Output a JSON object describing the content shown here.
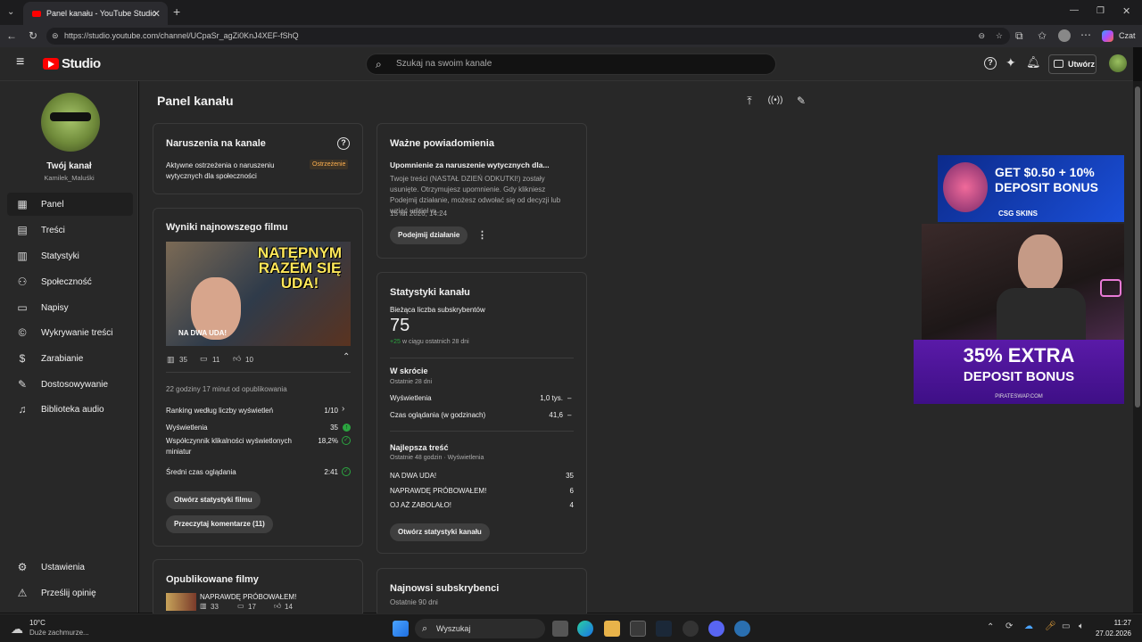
{
  "browser": {
    "tab_title": "Panel kanału - YouTube Studio",
    "url": "https://studio.youtube.com/channel/UCpaSr_agZi0KnJ4XEF-fShQ",
    "chat_label": "Czat"
  },
  "header": {
    "logo_text": "Studio",
    "search_placeholder": "Szukaj na swoim kanale",
    "create_label": "Utwórz"
  },
  "sidebar": {
    "channel_title": "Twój kanał",
    "channel_handle": "Kamilek_Maluśki",
    "items": [
      {
        "label": "Panel",
        "icon": "dashboard-icon"
      },
      {
        "label": "Treści",
        "icon": "content-icon"
      },
      {
        "label": "Statystyki",
        "icon": "analytics-icon"
      },
      {
        "label": "Społeczność",
        "icon": "community-icon"
      },
      {
        "label": "Napisy",
        "icon": "subtitles-icon"
      },
      {
        "label": "Wykrywanie treści",
        "icon": "copyright-icon"
      },
      {
        "label": "Zarabianie",
        "icon": "monetization-icon"
      },
      {
        "label": "Dostosowywanie",
        "icon": "customization-icon"
      },
      {
        "label": "Biblioteka audio",
        "icon": "audio-library-icon"
      }
    ],
    "settings_label": "Ustawienia",
    "feedback_label": "Prześlij opinię"
  },
  "page_title": "Panel kanału",
  "violations": {
    "title": "Naruszenia na kanale",
    "text": "Aktywne ostrzeżenia o naruszeniu wytycznych dla społeczności",
    "badge": "Ostrzeżenie"
  },
  "latest": {
    "title": "Wyniki najnowszego filmu",
    "thumb_text_top": "NATĘPNYM RAZEM SIĘ UDA!",
    "thumb_caption": "NA DWA UDA!",
    "views": "35",
    "comments": "11",
    "likes": "10",
    "published": "22 godziny 17 minut od opublikowania",
    "rows": [
      {
        "label": "Ranking według liczby wyświetleń",
        "value": "1/10"
      },
      {
        "label": "Wyświetlenia",
        "value": "35"
      },
      {
        "label": "Współczynnik klikalności wyświetlonych miniatur",
        "value": "18,2%"
      },
      {
        "label": "Średni czas oglądania",
        "value": "2:41"
      }
    ],
    "btn_stats": "Otwórz statystyki filmu",
    "btn_comments": "Przeczytaj komentarze (11)"
  },
  "published_videos": {
    "title": "Opublikowane filmy",
    "item_title": "NAPRAWDĘ PRÓBOWAŁEM!",
    "item_views": "33",
    "item_comments": "17",
    "item_likes": "14"
  },
  "notifications": {
    "title": "Ważne powiadomienia",
    "subtitle": "Upomnienie za naruszenie wytycznych dla...",
    "body": "Twoje treści (NASTAŁ DZIEŃ ODKUTKI!) zostały usunięte. Otrzymujesz upomnienie. Gdy klikniesz Podejmij działanie, możesz odwołać się od decyzji lub wziąć udział w...",
    "date": "15 lut 2026, 14:24",
    "action": "Podejmij działanie"
  },
  "channel_stats": {
    "title": "Statystyki kanału",
    "subs_label": "Bieżąca liczba subskrybentów",
    "subs_value": "75",
    "subs_change": "+25",
    "subs_change_suffix": "w ciągu ostatnich 28 dni",
    "summary_title": "W skrócie",
    "summary_sub": "Ostatnie 28 dni",
    "summary_rows": [
      {
        "label": "Wyświetlenia",
        "value": "1,0 tys.",
        "trend": "–"
      },
      {
        "label": "Czas oglądania (w godzinach)",
        "value": "41,6",
        "trend": "–"
      }
    ],
    "top_title": "Najlepsza treść",
    "top_sub": "Ostatnie 48 godzin · Wyświetlenia",
    "top_rows": [
      {
        "label": "NA DWA UDA!",
        "value": "35"
      },
      {
        "label": "NAPRAWDĘ PRÓBOWAŁEM!",
        "value": "6"
      },
      {
        "label": "OJ AŻ ZABOLAŁO!",
        "value": "4"
      }
    ],
    "btn": "Otwórz statystyki kanału"
  },
  "new_subs": {
    "title": "Najnowsi subskrybenci",
    "sub": "Ostatnie 90 dni"
  },
  "ads": {
    "ad1_line1": "GET $0.50 + 10%",
    "ad1_line2": "DEPOSIT BONUS",
    "ad1_brand": "CSG SKINS",
    "ad2_line1": "35% EXTRA",
    "ad2_line2": "DEPOSIT BONUS",
    "ad2_brand": "PIRATESWAP.COM"
  },
  "taskbar": {
    "weather_temp": "10°C",
    "weather_desc": "Duże zachmurze...",
    "search": "Wyszukaj",
    "time": "11:27",
    "date": "27.02.2026"
  },
  "colors": {
    "accent_green": "#2ba640",
    "badge_orange": "#ffb14f",
    "youtube_red": "#ff0000"
  }
}
